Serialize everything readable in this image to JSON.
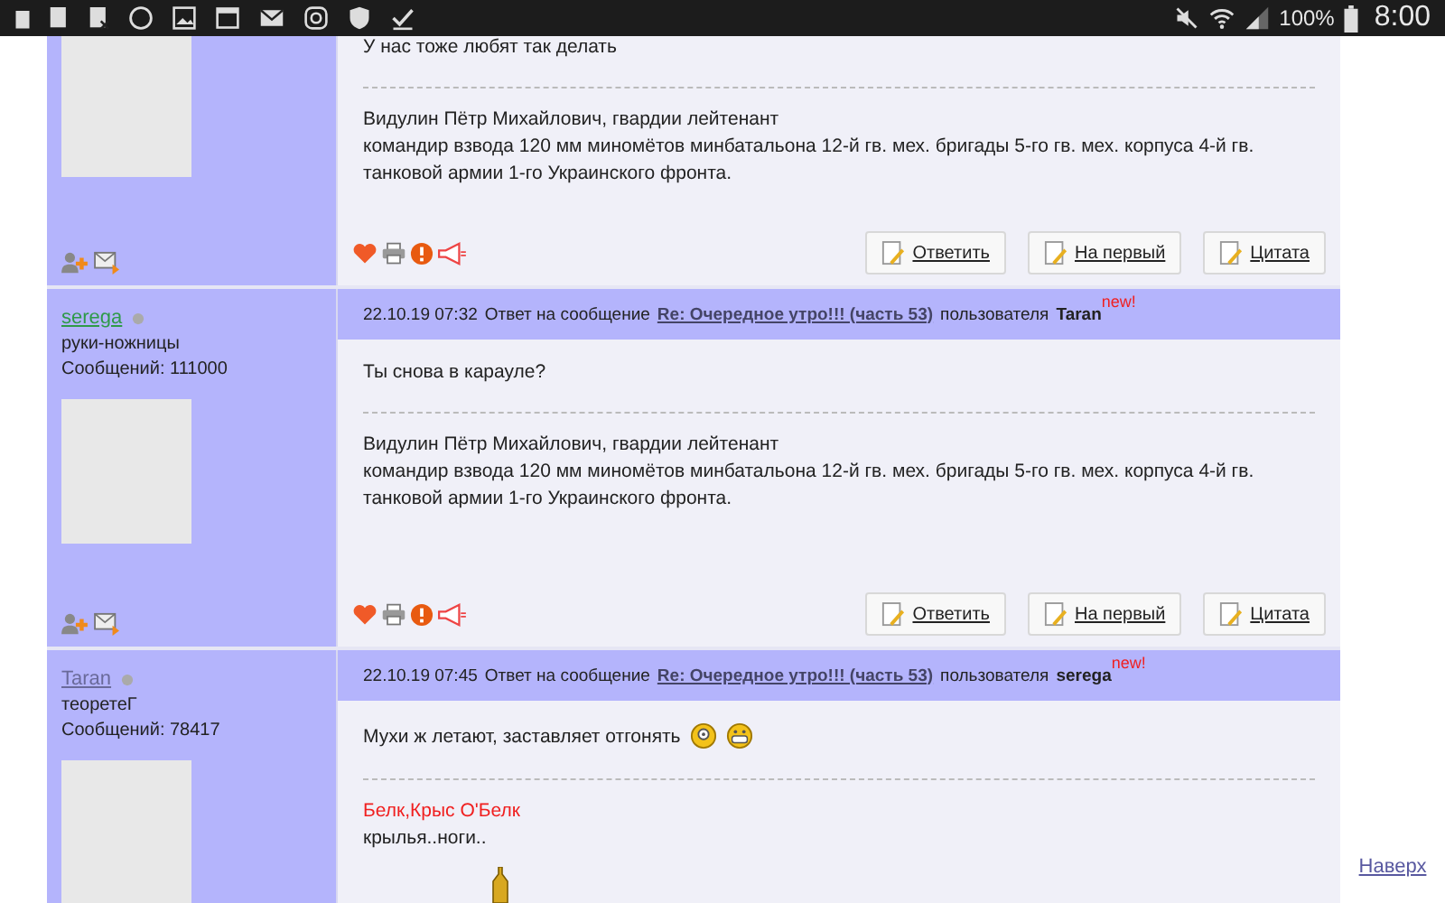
{
  "status_bar": {
    "battery": "100%",
    "time": "8:00"
  },
  "posts": [
    {
      "body": "У нас тоже любят так делать",
      "signature": [
        {
          "kind": "plain",
          "text": "Видулин Пётр Михайлович, гвардии лейтенант"
        },
        {
          "kind": "plain",
          "text": "командир взвода 120 мм миномётов минбатальона 12-й гв. мех. бригады 5-го гв. мех. корпуса 4-й гв. танковой армии 1-го Украинского фронта."
        }
      ],
      "buttons": [
        "Ответить",
        "На первый",
        "Цитата"
      ]
    },
    {
      "author": {
        "name": "serega",
        "color": "#2e9a48",
        "title": "руки-ножницы",
        "posts": "Сообщений: 111000"
      },
      "header": {
        "date": "22.10.19 07:32",
        "prefix": "Ответ на сообщение",
        "topic": "Re: Очередное утро!!! (часть 53)",
        "by": "пользователя",
        "reply_to": "Taran",
        "badge": "new!"
      },
      "body": "Ты снова в карауле?",
      "signature": [
        {
          "kind": "plain",
          "text": "Видулин Пётр Михайлович, гвардии лейтенант"
        },
        {
          "kind": "plain",
          "text": "командир взвода 120 мм миномётов минбатальона 12-й гв. мех. бригады 5-го гв. мех. корпуса 4-й гв. танковой армии 1-го Украинского фронта."
        }
      ],
      "buttons": [
        "Ответить",
        "На первый",
        "Цитата"
      ]
    },
    {
      "author": {
        "name": "Taran",
        "color": "#6a6a9a",
        "title": "теоретеГ",
        "posts": "Сообщений: 78417"
      },
      "header": {
        "date": "22.10.19 07:45",
        "prefix": "Ответ на сообщение",
        "topic": "Re: Очередное утро!!! (часть 53)",
        "by": "пользователя",
        "reply_to": "serega",
        "badge": "new!"
      },
      "body": "Мухи ж летают, заставляет отгонять",
      "has_emoticons": true,
      "signature": [
        {
          "kind": "highlight",
          "text": "Белк,Крыс О'Белк"
        },
        {
          "kind": "plain",
          "text": "крылья..ноги.."
        }
      ]
    }
  ],
  "top_link": "Наверх"
}
